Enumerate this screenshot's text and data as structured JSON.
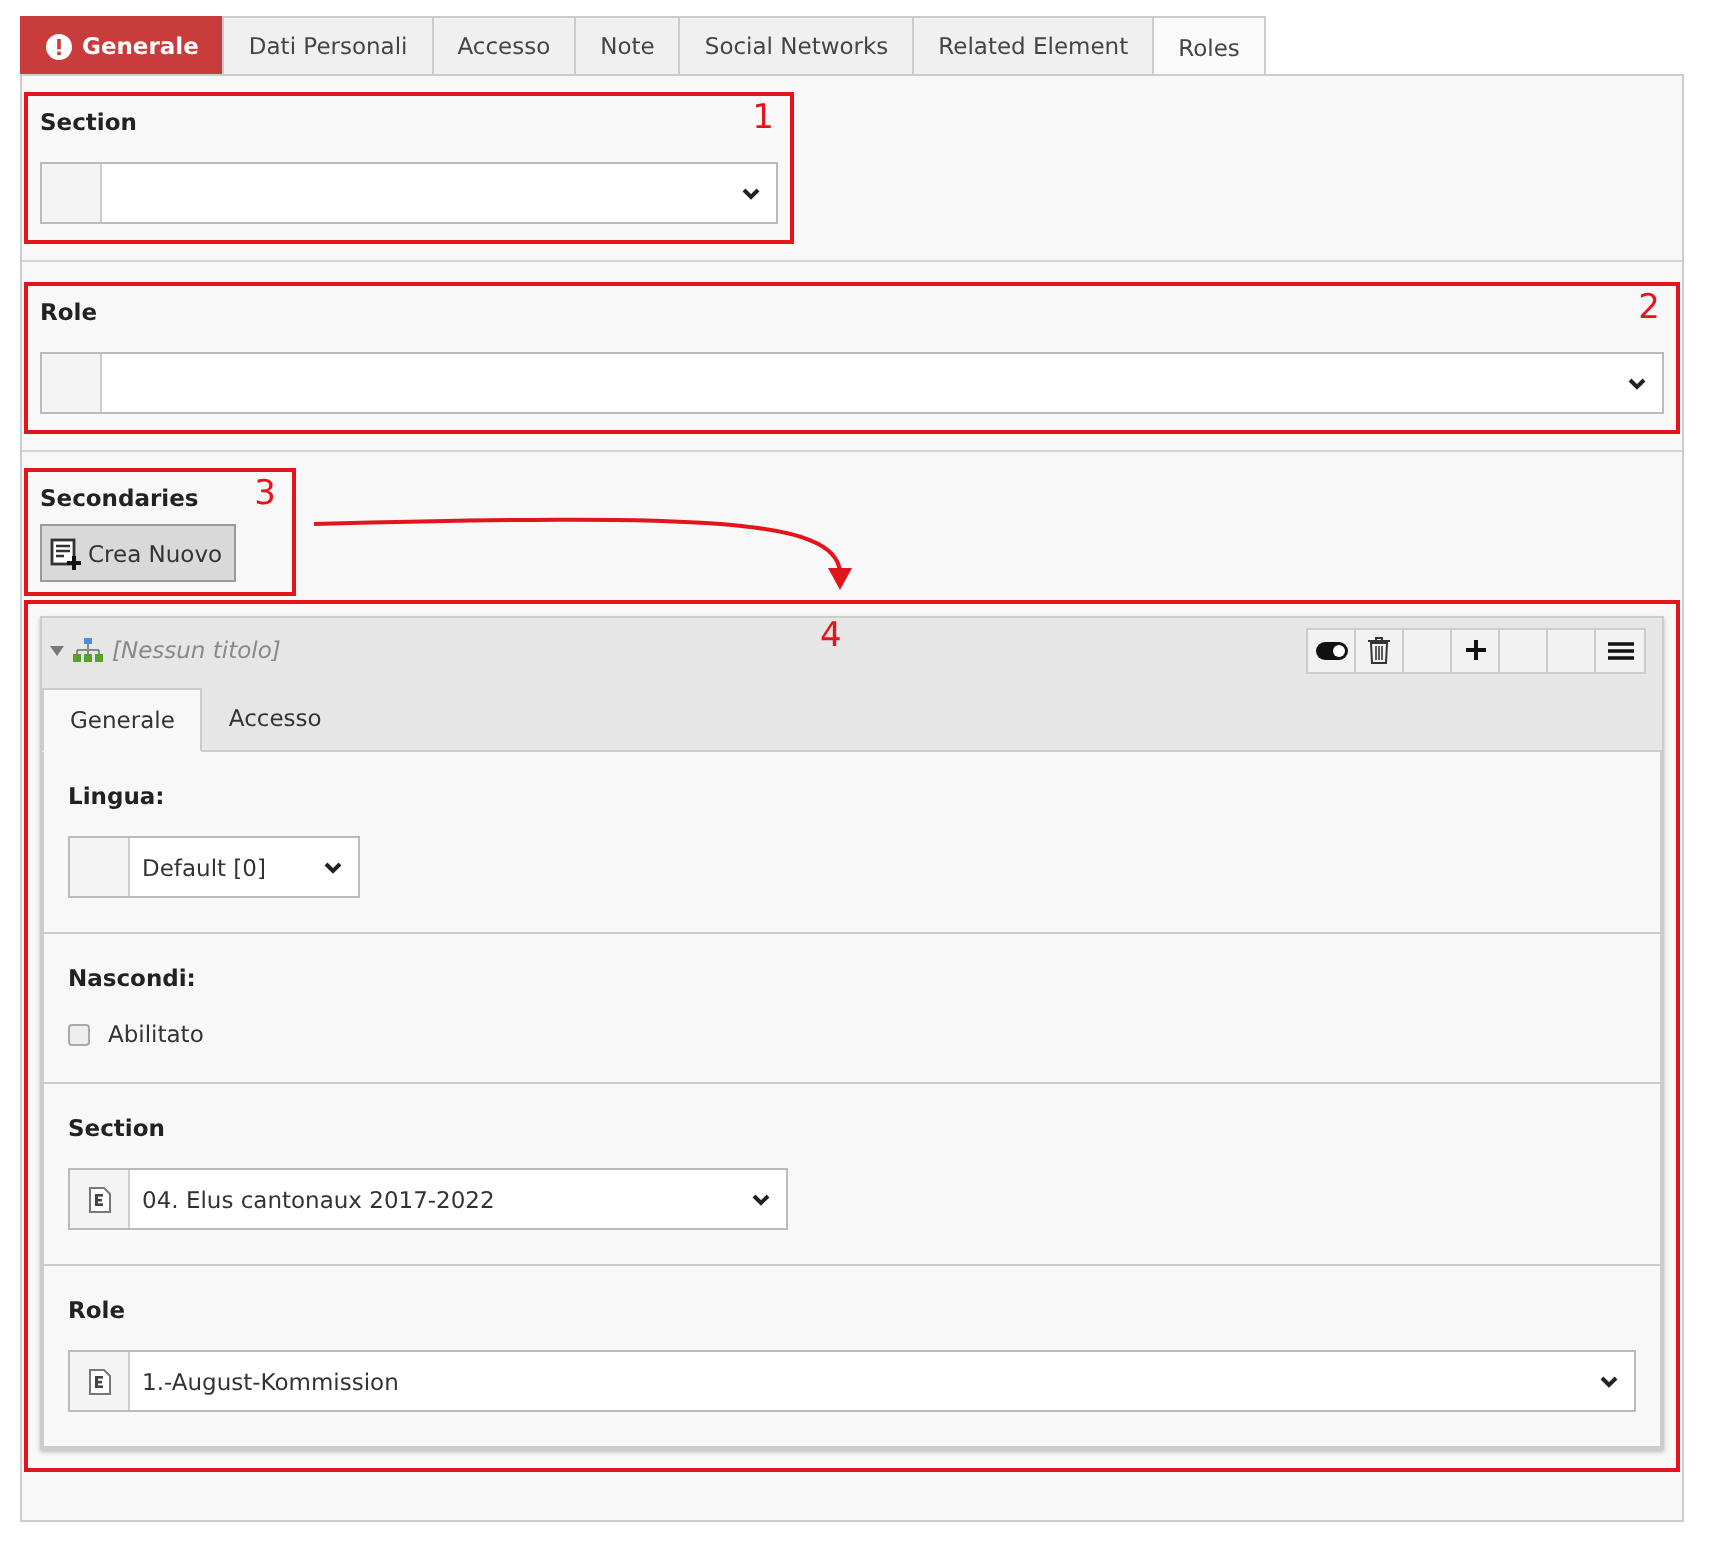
{
  "tabs": [
    {
      "label": "Generale",
      "selected": false,
      "error": true
    },
    {
      "label": "Dati Personali",
      "selected": false,
      "error": false
    },
    {
      "label": "Accesso",
      "selected": false,
      "error": false
    },
    {
      "label": "Note",
      "selected": false,
      "error": false
    },
    {
      "label": "Social Networks",
      "selected": false,
      "error": false
    },
    {
      "label": "Related Element",
      "selected": false,
      "error": false
    },
    {
      "label": "Roles",
      "selected": true,
      "error": false
    }
  ],
  "section": {
    "label": "Section",
    "annotation": {
      "label": "1"
    }
  },
  "role": {
    "label": "Role",
    "annotation": {
      "label": "2"
    }
  },
  "secondaries": {
    "label": "Secondaries",
    "button": "Crea Nuovo",
    "annotation": {
      "label": "3"
    }
  },
  "record": {
    "annotation": {
      "label": "4"
    },
    "title": "[Nessun titolo]",
    "expanded": true,
    "controls": [
      {
        "kind": "toggle"
      },
      {
        "kind": "delete"
      },
      {
        "kind": "blank"
      },
      {
        "kind": "add"
      },
      {
        "kind": "blank"
      },
      {
        "kind": "blank"
      },
      {
        "kind": "menu"
      }
    ],
    "tabs": [
      {
        "label": "Generale",
        "selected": true
      },
      {
        "label": "Accesso",
        "selected": false
      }
    ],
    "fields": [
      {
        "kind": "select",
        "label": "Lingua:",
        "value": "Default [0]",
        "icon": false
      },
      {
        "kind": "checkbox",
        "label": "Nascondi:",
        "option": "Abilitato",
        "checked": false
      },
      {
        "kind": "select",
        "label": "Section",
        "value": "04. Elus cantonaux 2017-2022",
        "icon": true
      },
      {
        "kind": "select",
        "label": "Role",
        "value": "1.-August-Kommission",
        "icon": true
      }
    ]
  }
}
